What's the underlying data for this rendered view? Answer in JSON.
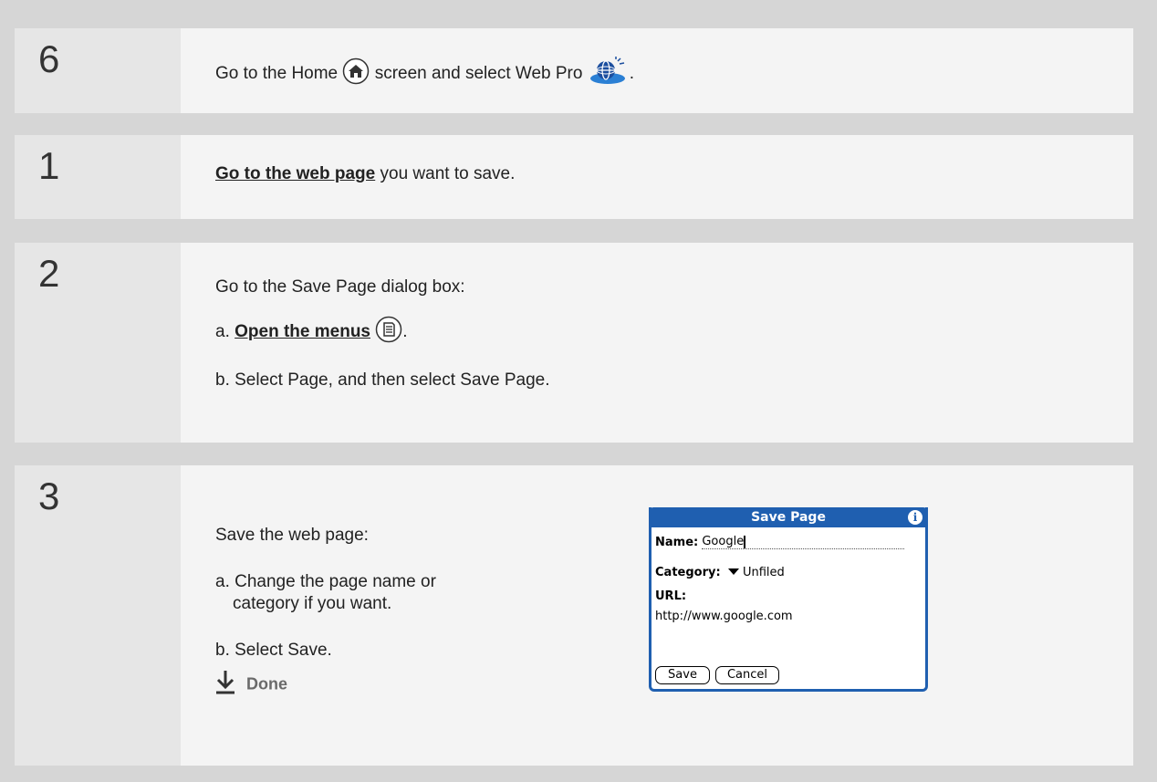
{
  "steps": [
    {
      "number": "6",
      "text_before": "Go to the Home",
      "text_middle": "screen and select Web Pro",
      "text_after": "."
    },
    {
      "number": "1",
      "link": "Go to the web page",
      "text": "you want to save."
    },
    {
      "number": "2",
      "intro": "Go to the Save Page dialog box:",
      "a_prefix": "a.",
      "a_link": "Open the menus",
      "a_after": ".",
      "b": "b. Select Page, and then select Save Page."
    },
    {
      "number": "3",
      "intro": "Save the web page:",
      "a_line1": "a. Change the page name or",
      "a_line2": "category if you want.",
      "b": "b. Select Save.",
      "done": "Done"
    }
  ],
  "dialog": {
    "title": "Save Page",
    "info_icon": "i",
    "name_label": "Name:",
    "name_value": "Google",
    "category_label": "Category:",
    "category_value": "Unfiled",
    "url_label": "URL:",
    "url_value": "http://www.google.com",
    "save_button": "Save",
    "cancel_button": "Cancel"
  },
  "icons": {
    "home": "home-icon",
    "web_pro": "web-pro-icon",
    "menu": "menu-icon",
    "done_arrow": "down-arrow-icon",
    "category_dropdown": "chevron-down-icon"
  },
  "colors": {
    "background": "#d6d6d6",
    "number_cell": "#e6e6e6",
    "body_cell": "#f4f4f4",
    "dialog_accent": "#1f5fb0"
  }
}
